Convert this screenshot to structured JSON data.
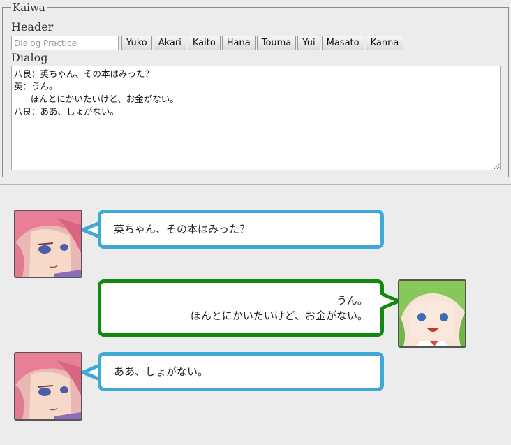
{
  "form": {
    "legend": "Kaiwa",
    "header_label": "Header",
    "header_placeholder": "Dialog Practice",
    "dialog_label": "Dialog",
    "dialog_text": "八良：英ちゃん、その本はみった？\n英：うん。\n      ほんとにかいたいけど、お金がない。\n八良：ああ、しょがない。",
    "buttons": [
      "Yuko",
      "Akari",
      "Kaito",
      "Hana",
      "Touma",
      "Yui",
      "Masato",
      "Kanna"
    ]
  },
  "conversation": [
    {
      "speaker_side": "left",
      "bubble_color": "#3fa9d6",
      "lines": [
        "英ちゃん、その本はみった？"
      ],
      "avatar": "pink-hair-character"
    },
    {
      "speaker_side": "right",
      "bubble_color": "#128a12",
      "lines": [
        "うん。",
        "ほんとにかいたいけど、お金がない。"
      ],
      "avatar": "green-hair-character"
    },
    {
      "speaker_side": "left",
      "bubble_color": "#3fa9d6",
      "lines": [
        "ああ、しょがない。"
      ],
      "avatar": "pink-hair-character"
    }
  ]
}
